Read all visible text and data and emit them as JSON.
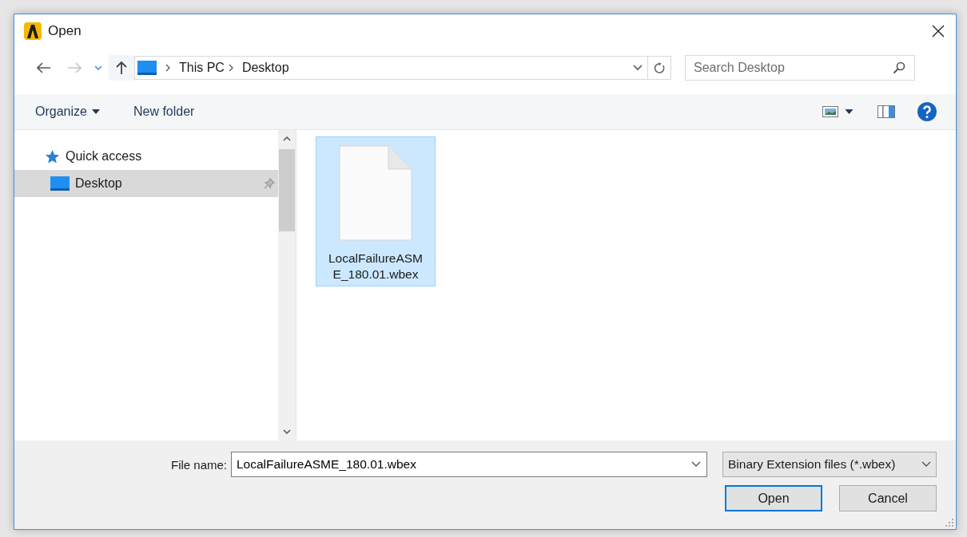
{
  "window": {
    "title": "Open"
  },
  "address_bar": {
    "breadcrumbs": [
      "This PC",
      "Desktop"
    ]
  },
  "search": {
    "placeholder": "Search Desktop"
  },
  "toolbar": [
    {
      "label": "Organize",
      "kind": "menu"
    },
    {
      "label": "New folder",
      "kind": "button"
    }
  ],
  "navigation_pane": {
    "items": [
      {
        "label": "Quick access",
        "kind": "star",
        "selected": false,
        "pinned": false
      },
      {
        "label": "Desktop",
        "kind": "desktop",
        "selected": true,
        "pinned": true
      }
    ]
  },
  "files": [
    {
      "name": "LocalFailureASME_180.01.wbex",
      "selected": true
    }
  ],
  "file_name": {
    "label": "File name:",
    "value": "LocalFailureASME_180.01.wbex"
  },
  "file_type": {
    "value": "Binary Extension files (*.wbex)"
  },
  "buttons": [
    {
      "label": "Open",
      "default": true
    },
    {
      "label": "Cancel",
      "default": false
    }
  ]
}
